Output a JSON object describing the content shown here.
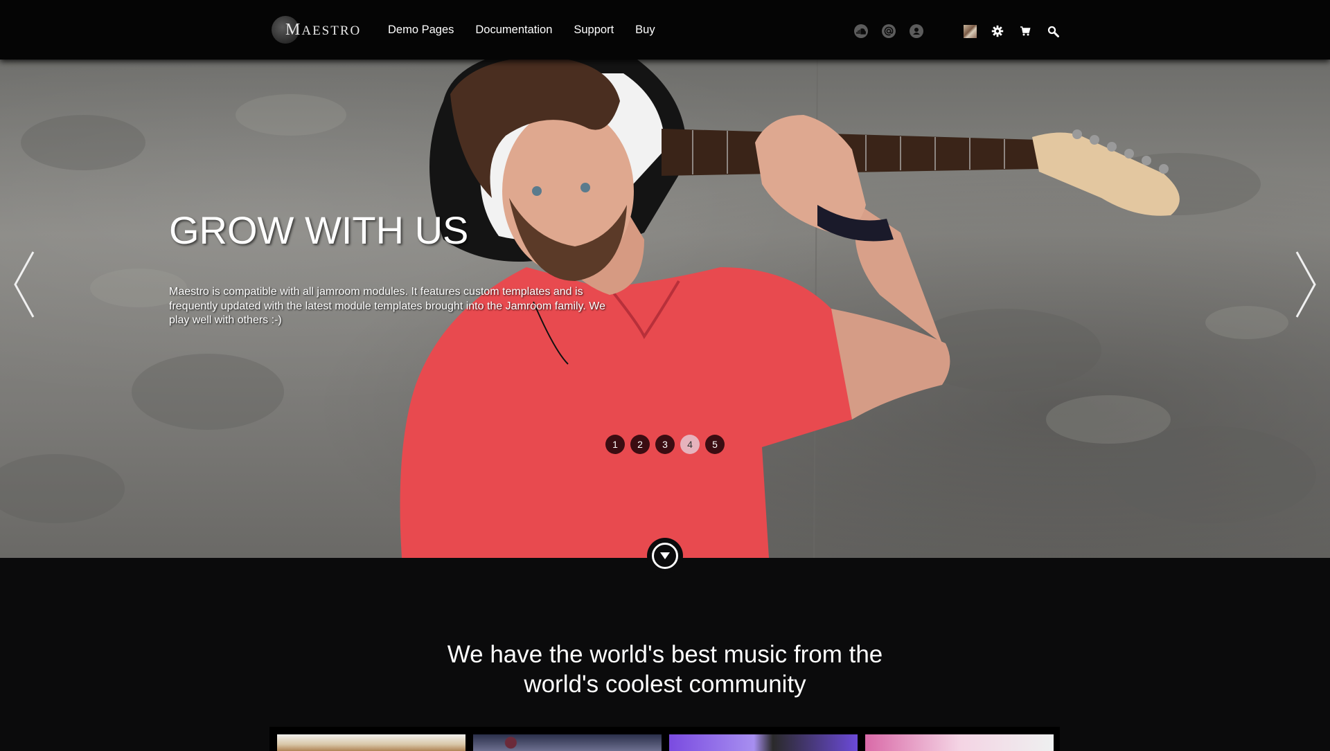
{
  "header": {
    "logo_initial": "M",
    "logo_rest": "AESTRO",
    "nav": [
      "Demo Pages",
      "Documentation",
      "Support",
      "Buy"
    ],
    "social_icons": [
      "soundcloud-icon",
      "at-icon",
      "profile-icon"
    ],
    "tool_icons": [
      "user-avatar",
      "gear-icon",
      "cart-icon",
      "search-icon"
    ]
  },
  "hero": {
    "title": "GROW WITH US",
    "text": "Maestro is compatible with all jamroom modules. It features custom templates and is frequently updated with the latest module templates brought into the Jamroom family. We play well with others :-)",
    "slides": [
      "1",
      "2",
      "3",
      "4",
      "5"
    ],
    "active_slide": 4,
    "colors": {
      "shirt": "#e84a4f",
      "wall": "#7c7b78"
    }
  },
  "section": {
    "headline_line1": "We have the world's best music from the",
    "headline_line2": "world's coolest community"
  }
}
